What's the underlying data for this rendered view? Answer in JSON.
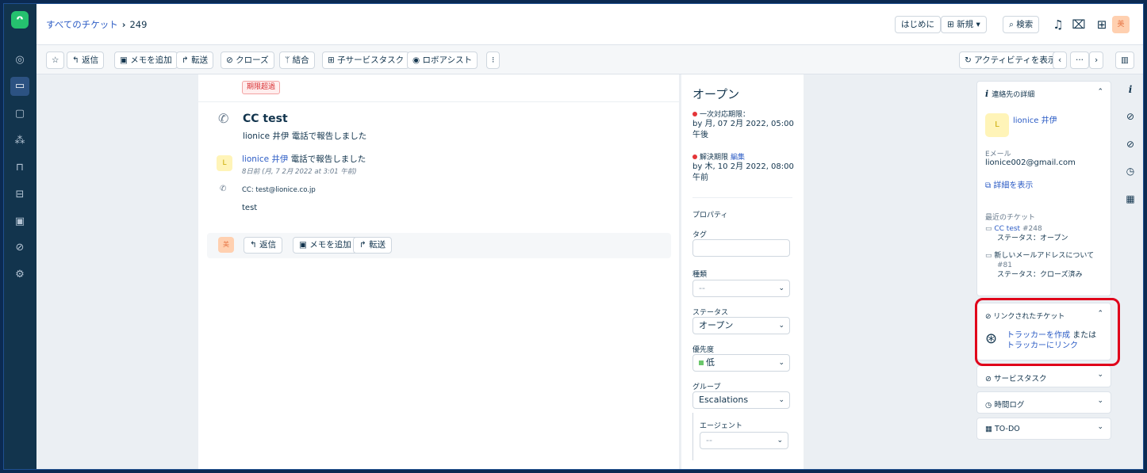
{
  "header": {
    "breadcrumb_link": "すべてのチケット",
    "breadcrumb_sep": "›",
    "ticket_id": "249",
    "getting_started": "はじめに",
    "new_label": "⊞ 新規 ▾",
    "search_label": "⌕ 検索",
    "user_avatar": "美"
  },
  "toolbar": {
    "star": "☆",
    "reply": "↰ 返信",
    "add_note": "▣ メモを追加",
    "forward": "↱ 転送",
    "close": "⊘ クローズ",
    "merge": "ᛘ 結合",
    "child_task": "⊞ 子サービスタスク",
    "robo_assist": "◉ ロボアシスト",
    "more": "⁝",
    "activity": "↻ アクティビティを表示",
    "prev": "‹",
    "mid": "···",
    "next": "›",
    "panel": "▥"
  },
  "conversation": {
    "overdue_badge": "期限超過",
    "subject": "CC test",
    "subline": "lionice 井伊 電話で報告しました",
    "avatar_initial": "L",
    "author_name": "lionice 井伊",
    "author_action": " 電話で報告しました",
    "timestamp": "8日前 (月, 7 2月 2022 at 3:01 午前)",
    "cc_line": "CC: test@lionice.co.jp",
    "body": "test",
    "reply_avatar": "美",
    "reply_button": "↰ 返信",
    "note_button": "▣ メモを追加",
    "forward_button": "↱ 転送"
  },
  "properties": {
    "status_heading": "オープン",
    "first_response_label": "一次対応期限：",
    "first_response_value": "by 月, 07 2月 2022, 05:00 午後",
    "resolution_label": "解決期限",
    "resolution_edit": "編集",
    "resolution_value": "by 木, 10 2月 2022, 08:00 午前",
    "section_title": "プロパティ",
    "tag_label": "タグ",
    "type_label": "種類",
    "type_value": "--",
    "status_label": "ステータス",
    "status_value": "オープン",
    "priority_label": "優先度",
    "priority_value": "低",
    "group_label": "グループ",
    "group_value": "Escalations",
    "agent_label": "エージェント",
    "agent_value": "--"
  },
  "sidebar": {
    "contact_title": "連絡先の詳細",
    "contact_avatar": "L",
    "contact_name": "lionice 井伊",
    "email_label": "Eメール",
    "email_value": "lionice002@gmail.com",
    "view_details": "詳細を表示",
    "recent_title": "最近のチケット",
    "recent": [
      {
        "title": "CC test",
        "number": "#248",
        "status_label": "ステータス：",
        "status": "オープン"
      },
      {
        "title": "新しいメールアドレスについて",
        "number": "#81",
        "status_label": "ステータス：",
        "status": "クローズ済み"
      }
    ],
    "linked_title": "リンクされたチケット",
    "create_tracker": "トラッカーを作成",
    "or_text": " または",
    "link_tracker": "トラッカーにリンク",
    "service_tasks": "サービスタスク",
    "time_log": "時間ログ",
    "todo": "TO-DO"
  },
  "colors": {
    "nav_bg": "#12344d",
    "link": "#2c5cc5",
    "highlight": "#e0001a",
    "overdue": "#d72d30",
    "logo": "#25c16f"
  },
  "icons": [
    "freshdesk-logo",
    "dashboard-icon",
    "tickets-icon",
    "contacts-icon",
    "social-icon",
    "knowledge-icon",
    "forums-icon",
    "reports-icon",
    "compass-icon",
    "gear-icon",
    "bell-icon",
    "gift-icon",
    "apps-icon",
    "phone-icon",
    "info-icon",
    "link-icon",
    "timer-icon",
    "calendar-icon",
    "tracker-icon"
  ]
}
